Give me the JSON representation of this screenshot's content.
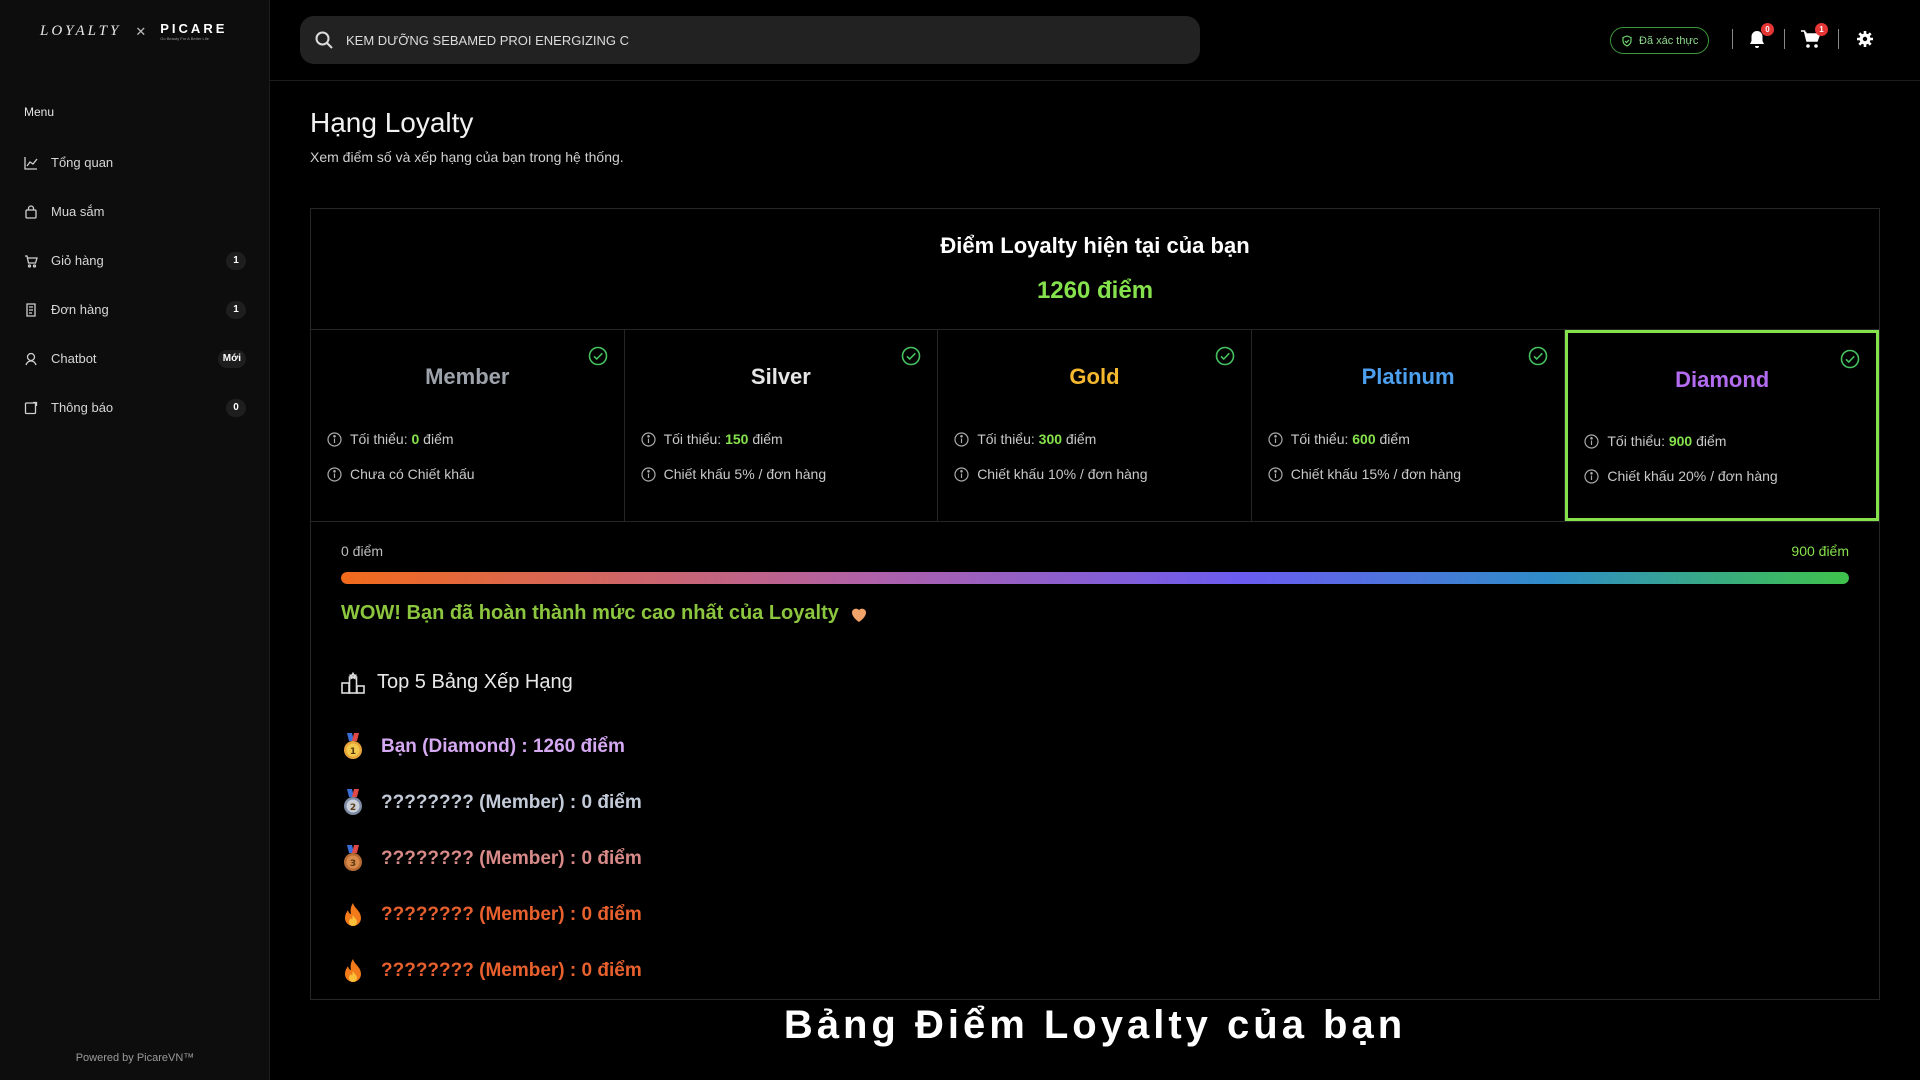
{
  "brand": {
    "loyalty": "LOYALTY",
    "x": "✕",
    "picare": "PICARE",
    "tagline": "Go Beauty For A Better Life"
  },
  "sidebar": {
    "menu_title": "Menu",
    "items": [
      {
        "label": "Tổng quan",
        "icon": "chart-line-icon",
        "badge": ""
      },
      {
        "label": "Mua sắm",
        "icon": "shopping-bag-icon",
        "badge": ""
      },
      {
        "label": "Giỏ hàng",
        "icon": "cart-icon",
        "badge": "1"
      },
      {
        "label": "Đơn hàng",
        "icon": "receipt-icon",
        "badge": "1"
      },
      {
        "label": "Chatbot",
        "icon": "chatbot-icon",
        "badge": "Mới"
      },
      {
        "label": "Thông báo",
        "icon": "notification-icon",
        "badge": "0"
      }
    ],
    "powered": "Powered by PicareVN™"
  },
  "header": {
    "search_value": "KEM DƯỠNG SEBAMED PROI ENERGIZING C",
    "verified_label": "Đã xác thực",
    "notif_count": "0",
    "cart_count": "1"
  },
  "page": {
    "title": "Hạng Loyalty",
    "subtitle": "Xem điểm số và xếp hạng của bạn trong hệ thống."
  },
  "points": {
    "title": "Điểm Loyalty hiện tại của bạn",
    "value": "1260 điểm"
  },
  "tiers": [
    {
      "name": "Member",
      "color": "#9ea3ab",
      "min_label": "Tối thiểu: ",
      "min_value": "0",
      "min_unit": " điểm",
      "discount": "Chưa có Chiết khấu"
    },
    {
      "name": "Silver",
      "color": "#e6e6e6",
      "min_label": "Tối thiểu: ",
      "min_value": "150",
      "min_unit": " điểm",
      "discount": "Chiết khấu 5% / đơn hàng"
    },
    {
      "name": "Gold",
      "color": "#f5b82e",
      "min_label": "Tối thiểu: ",
      "min_value": "300",
      "min_unit": " điểm",
      "discount": "Chiết khấu 10% / đơn hàng"
    },
    {
      "name": "Platinum",
      "color": "#4da0f0",
      "min_label": "Tối thiểu: ",
      "min_value": "600",
      "min_unit": " điểm",
      "discount": "Chiết khấu 15% / đơn hàng"
    },
    {
      "name": "Diamond",
      "color": "#b36cf0",
      "min_label": "Tối thiểu: ",
      "min_value": "900",
      "min_unit": " điểm",
      "discount": "Chiết khấu 20% / đơn hàng"
    }
  ],
  "active_tier": "Diamond",
  "progress": {
    "min_label": "0 điểm",
    "max_label": "900 điểm",
    "fraction": 1.0
  },
  "wow_message": "WOW! Bạn đã hoàn thành mức cao nhất của Loyalty",
  "leaderboard": {
    "title": "Top 5 Bảng Xếp Hạng",
    "rows": [
      {
        "medal": "gold-medal-icon",
        "text": "Bạn (Diamond) : 1260 điểm"
      },
      {
        "medal": "silver-medal-icon",
        "text": "???????? (Member) : 0 điểm"
      },
      {
        "medal": "bronze-medal-icon",
        "text": "???????? (Member) : 0 điểm"
      },
      {
        "medal": "fire-icon",
        "text": "???????? (Member) : 0 điểm"
      },
      {
        "medal": "fire-icon",
        "text": "???????? (Member) : 0 điểm"
      }
    ]
  },
  "caption": "Bảng Điểm Loyalty của bạn"
}
